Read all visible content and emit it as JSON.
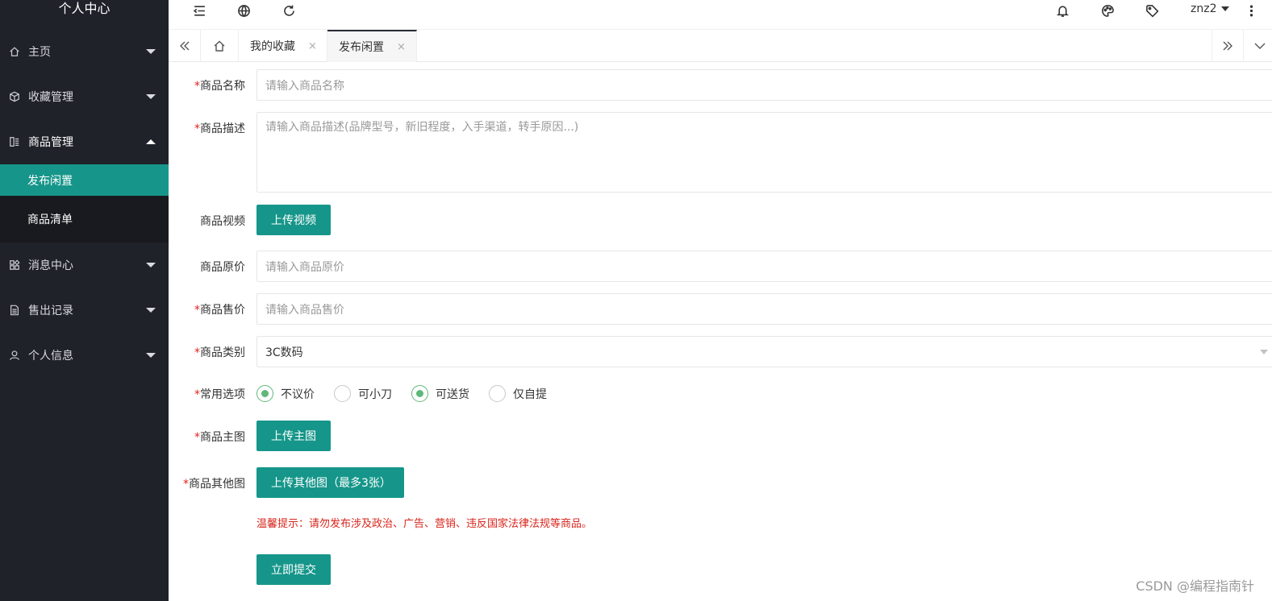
{
  "sidebar": {
    "title": "个人中心",
    "items": [
      {
        "label": "主页",
        "icon": "home-icon"
      },
      {
        "label": "收藏管理",
        "icon": "cube-icon"
      },
      {
        "label": "商品管理",
        "icon": "goods-icon"
      },
      {
        "label": "消息中心",
        "icon": "apps-icon"
      },
      {
        "label": "售出记录",
        "icon": "file-icon"
      },
      {
        "label": "个人信息",
        "icon": "user-icon"
      }
    ],
    "sub_items": [
      {
        "label": "发布闲置",
        "active": true
      },
      {
        "label": "商品清单",
        "active": false
      }
    ]
  },
  "header": {
    "username": "znz2"
  },
  "tabs": [
    {
      "label": "我的收藏",
      "active": false,
      "close": "×"
    },
    {
      "label": "发布闲置",
      "active": true,
      "close": "×"
    }
  ],
  "form": {
    "required_mark": "*",
    "name": {
      "label": "商品名称",
      "placeholder": "请输入商品名称"
    },
    "desc": {
      "label": "商品描述",
      "placeholder": "请输入商品描述(品牌型号，新旧程度，入手渠道，转手原因...)"
    },
    "video": {
      "label": "商品视频",
      "button": "上传视频"
    },
    "orig_price": {
      "label": "商品原价",
      "placeholder": "请输入商品原价"
    },
    "price": {
      "label": "商品售价",
      "placeholder": "请输入商品售价"
    },
    "category": {
      "label": "商品类别",
      "value": "3C数码"
    },
    "options": {
      "label": "常用选项",
      "items": [
        {
          "label": "不议价",
          "checked": true
        },
        {
          "label": "可小刀",
          "checked": false
        },
        {
          "label": "可送货",
          "checked": true
        },
        {
          "label": "仅自提",
          "checked": false
        }
      ]
    },
    "main_image": {
      "label": "商品主图",
      "button": "上传主图"
    },
    "other_images": {
      "label": "商品其他图",
      "button": "上传其他图（最多3张）"
    },
    "tip": "温馨提示：请勿发布涉及政治、广告、营销、违反国家法律法规等商品。",
    "submit": "立即提交"
  },
  "watermark": "CSDN @编程指南针"
}
